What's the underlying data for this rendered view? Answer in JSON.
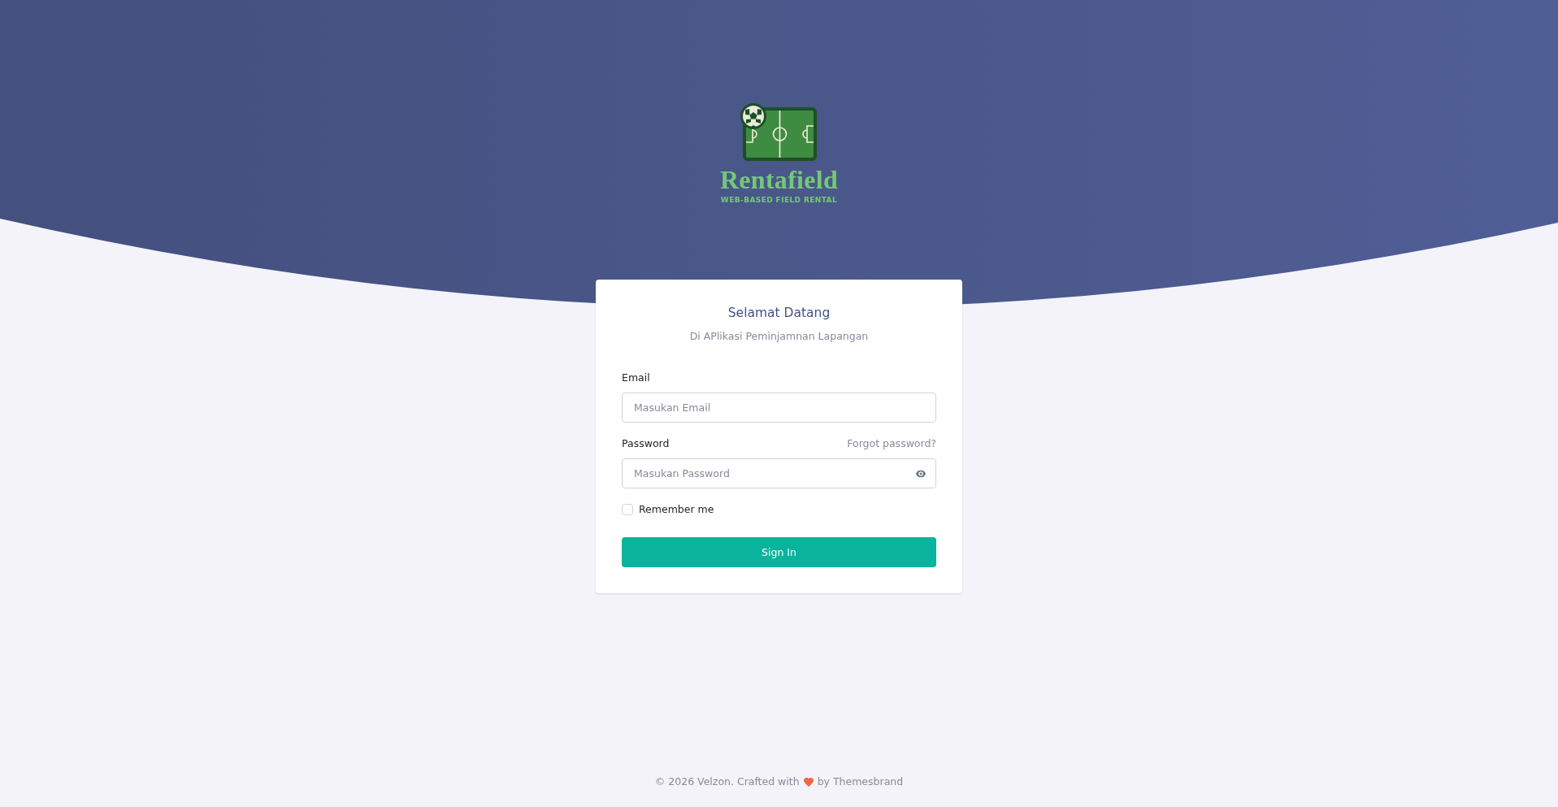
{
  "brand": {
    "name": "Rentafield",
    "tagline": "WEB-BASED FIELD RENTAL"
  },
  "card": {
    "title": "Selamat Datang",
    "subtitle": "Di APlikasi Peminjamnan Lapangan",
    "fields": [
      {
        "kind": "text",
        "label": "Email",
        "placeholder": "Masukan Email"
      },
      {
        "kind": "password",
        "label": "Password",
        "placeholder": "Masukan Password",
        "link": "Forgot password?"
      }
    ],
    "remember": {
      "label": "Remember me",
      "checked": false
    },
    "button": "Sign In"
  },
  "footer": {
    "text_before": "© 2026 Velzon. Crafted with",
    "text_after": "by Themesbrand"
  }
}
